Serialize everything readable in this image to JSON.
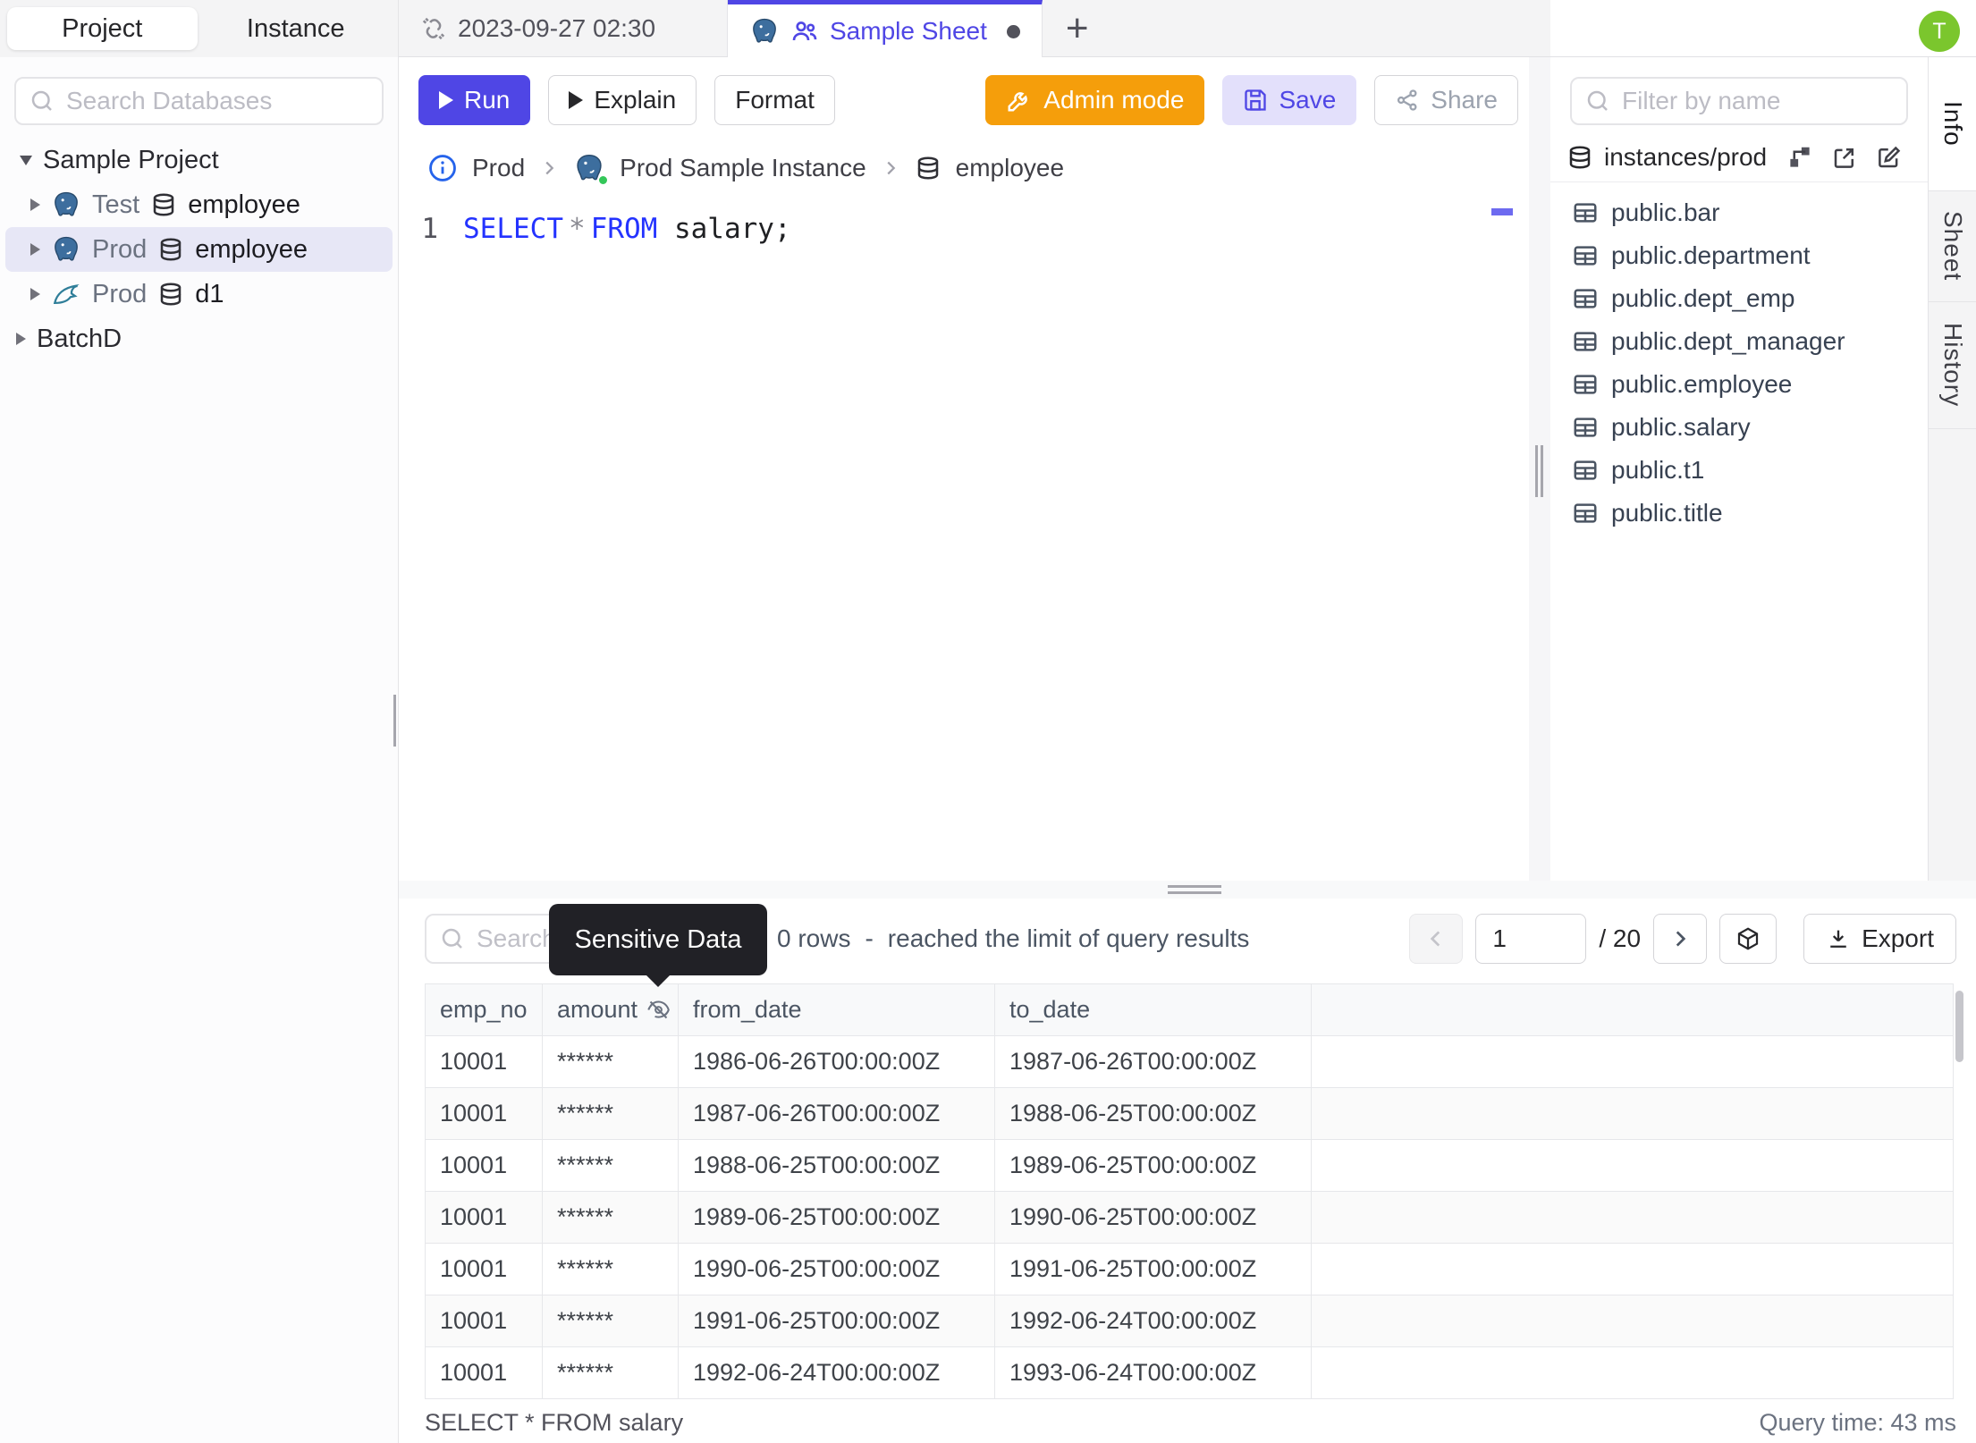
{
  "colors": {
    "accent": "#4f46e5",
    "admin_orange": "#f59e0b",
    "avatar_green": "#7bc62d",
    "keyword_blue": "#2433ff",
    "tooltip_bg": "#212126",
    "selected_row_bg": "#e7e7f6"
  },
  "sidebar": {
    "tabs": {
      "project": "Project",
      "instance": "Instance"
    },
    "search_placeholder": "Search Databases",
    "tree": {
      "project1": "Sample Project",
      "items": [
        {
          "env": "Test",
          "db": "employee",
          "engine": "postgresql"
        },
        {
          "env": "Prod",
          "db": "employee",
          "engine": "postgresql"
        },
        {
          "env": "Prod",
          "db": "d1",
          "engine": "mysql"
        }
      ],
      "project2": "BatchD"
    }
  },
  "topbar": {
    "tab1": "2023-09-27 02:30",
    "tab2": "Sample Sheet",
    "new_tab": "+",
    "avatar": "T"
  },
  "toolbar": {
    "run": "Run",
    "explain": "Explain",
    "format": "Format",
    "admin_mode": "Admin mode",
    "save": "Save",
    "share": "Share"
  },
  "breadcrumb": {
    "env": "Prod",
    "instance": "Prod Sample Instance",
    "database": "employee"
  },
  "editor": {
    "line_number": "1",
    "kw_select": "SELECT",
    "star": "*",
    "kw_from": "FROM",
    "rest": "salary;"
  },
  "right_panel": {
    "filter_placeholder": "Filter by name",
    "connection": "instances/prod",
    "tables": [
      "public.bar",
      "public.department",
      "public.dept_emp",
      "public.dept_manager",
      "public.employee",
      "public.salary",
      "public.t1",
      "public.title"
    ]
  },
  "side_tabs": {
    "info": "Info",
    "sheet": "Sheet",
    "history": "History"
  },
  "results": {
    "search_placeholder": "Search",
    "tooltip": "Sensitive Data",
    "rows_count": "0 rows",
    "rows_sep": "-",
    "rows_note": "reached the limit of query results",
    "page_value": "1",
    "page_total": "/ 20",
    "export_label": "Export",
    "table": {
      "headers": [
        "emp_no",
        "amount",
        "from_date",
        "to_date"
      ],
      "rows": [
        [
          "10001",
          "******",
          "1986-06-26T00:00:00Z",
          "1987-06-26T00:00:00Z"
        ],
        [
          "10001",
          "******",
          "1987-06-26T00:00:00Z",
          "1988-06-25T00:00:00Z"
        ],
        [
          "10001",
          "******",
          "1988-06-25T00:00:00Z",
          "1989-06-25T00:00:00Z"
        ],
        [
          "10001",
          "******",
          "1989-06-25T00:00:00Z",
          "1990-06-25T00:00:00Z"
        ],
        [
          "10001",
          "******",
          "1990-06-25T00:00:00Z",
          "1991-06-25T00:00:00Z"
        ],
        [
          "10001",
          "******",
          "1991-06-25T00:00:00Z",
          "1992-06-24T00:00:00Z"
        ],
        [
          "10001",
          "******",
          "1992-06-24T00:00:00Z",
          "1993-06-24T00:00:00Z"
        ]
      ]
    },
    "status_query": "SELECT * FROM salary",
    "status_time": "Query time: 43 ms"
  }
}
